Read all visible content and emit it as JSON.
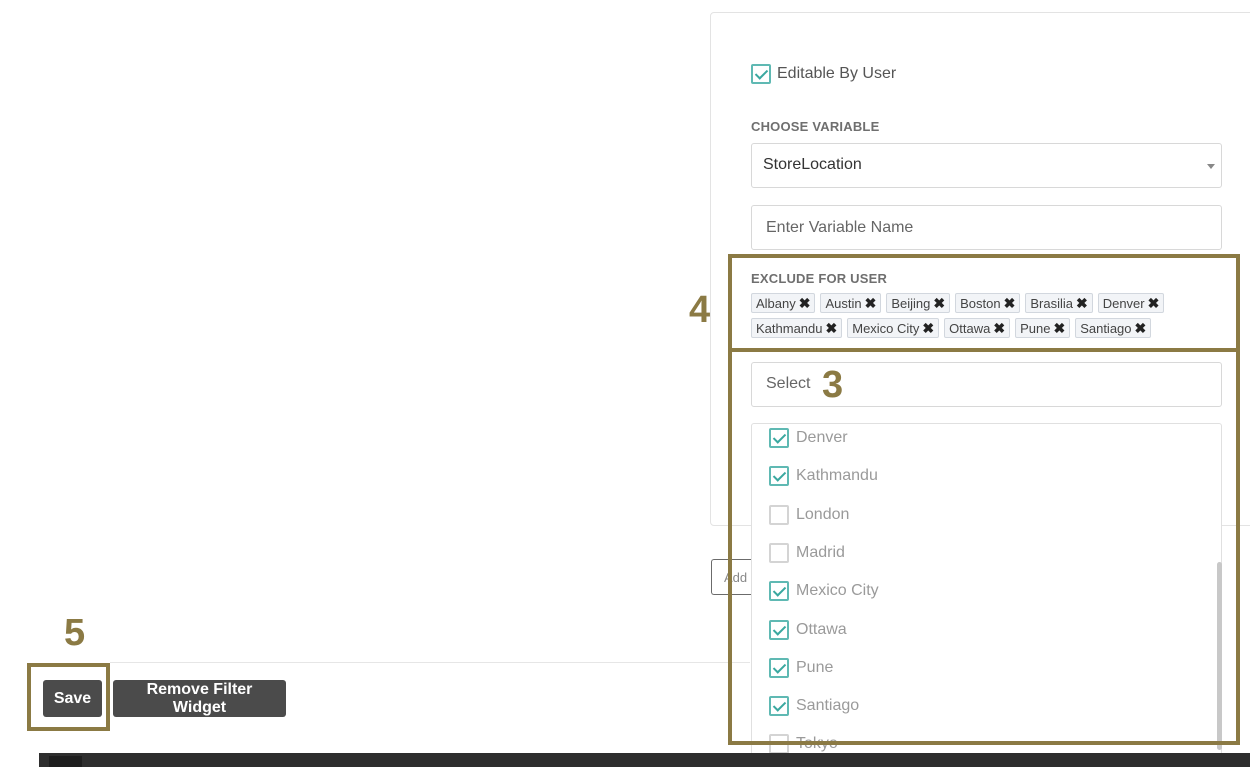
{
  "panel": {
    "editable_label": "Editable By User",
    "editable_checked": true,
    "choose_variable_label": "CHOOSE VARIABLE",
    "choose_variable_value": "StoreLocation",
    "variable_name_placeholder": "Enter Variable Name",
    "exclude_label": "EXCLUDE FOR USER",
    "excluded_tags": [
      "Albany",
      "Austin",
      "Beijing",
      "Boston",
      "Brasilia",
      "Denver",
      "Kathmandu",
      "Mexico City",
      "Ottawa",
      "Pune",
      "Santiago"
    ],
    "select_placeholder": "Select",
    "options": [
      {
        "label": "Denver",
        "checked": true
      },
      {
        "label": "Kathmandu",
        "checked": true
      },
      {
        "label": "London",
        "checked": false
      },
      {
        "label": "Madrid",
        "checked": false
      },
      {
        "label": "Mexico City",
        "checked": true
      },
      {
        "label": "Ottawa",
        "checked": true
      },
      {
        "label": "Pune",
        "checked": true
      },
      {
        "label": "Santiago",
        "checked": true
      },
      {
        "label": "Tokyo",
        "checked": false
      }
    ]
  },
  "add_button_label": "Add",
  "footer": {
    "save_label": "Save",
    "remove_label": "Remove Filter Widget"
  },
  "annotations": {
    "step3": "3",
    "step4": "4",
    "step5": "5"
  },
  "colors": {
    "annotation": "#8b7a44",
    "checkbox": "#5fb9b3",
    "button_bg": "#4b4b4b"
  }
}
